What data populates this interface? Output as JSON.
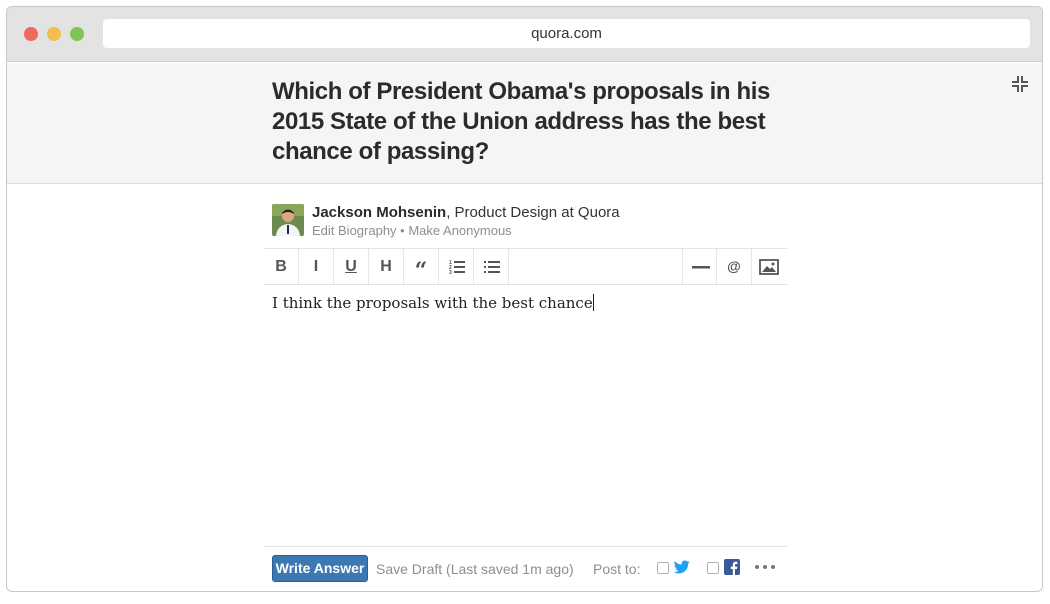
{
  "browser": {
    "url": "quora.com"
  },
  "question": {
    "title": "Which of President Obama's proposals in his 2015 State of the Union address has the best chance of passing?"
  },
  "author": {
    "name": "Jackson Mohsenin",
    "credential": ", Product Design at Quora",
    "edit_biography": "Edit Biography",
    "separator": " • ",
    "make_anonymous": "Make Anonymous"
  },
  "toolbar": {
    "bold": "B",
    "italic": "I",
    "underline": "U",
    "heading": "H",
    "quote": "“",
    "mention": "@"
  },
  "editor": {
    "text": "I think the proposals with the best chance"
  },
  "footer": {
    "write_answer": "Write Answer",
    "save_draft": "Save Draft (Last saved 1m ago)",
    "post_to": "Post to:"
  },
  "colors": {
    "primary_button": "#3e78b2",
    "twitter": "#1da1f2",
    "facebook": "#3b5998"
  },
  "icons": {
    "collapse": "collapse-icon",
    "ordered_list": "ordered-list-icon",
    "bullet_list": "bullet-list-icon",
    "divider": "horizontal-rule-icon",
    "image": "image-icon",
    "twitter": "twitter-icon",
    "facebook": "facebook-icon",
    "more": "more-icon"
  }
}
